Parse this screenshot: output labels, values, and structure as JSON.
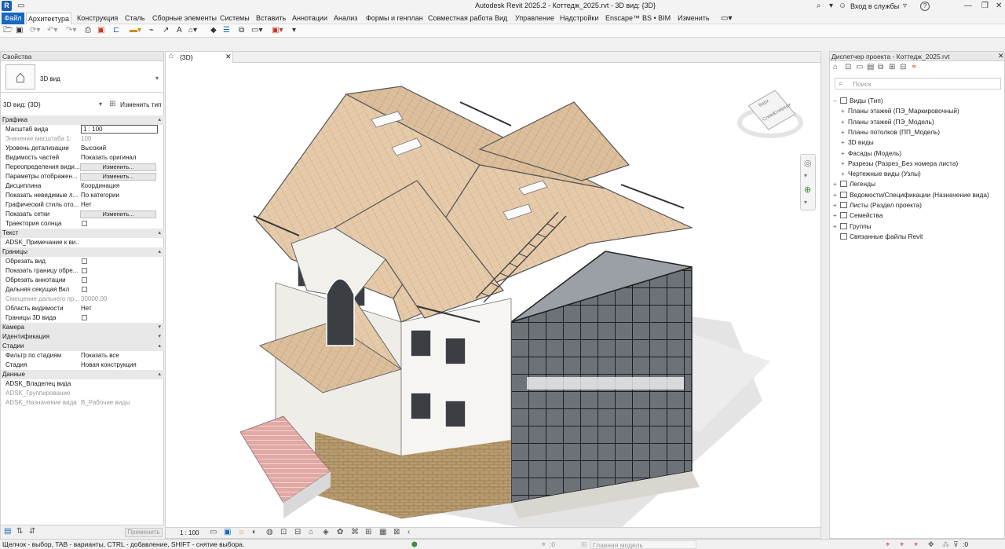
{
  "app": {
    "logo": "R",
    "window_title": "Autodesk Revit 2025.2 - Коттедж_2025.rvt - 3D вид: {3D}",
    "signin_label": "Вход в службы",
    "help_label": "?"
  },
  "menu": {
    "file": "Файл",
    "items": [
      "Архитектура",
      "Конструкция",
      "Сталь",
      "Сборные элементы",
      "Системы",
      "Вставить",
      "Аннотации",
      "Анализ",
      "Формы и генплан",
      "Совместная работа",
      "Вид",
      "Управление",
      "Надстройки",
      "Enscape™",
      "BS • BIM",
      "Изменить"
    ]
  },
  "properties": {
    "title": "Свойства",
    "type_name": "3D вид",
    "selector": "3D вид: {3D}",
    "edit_type": "Изменить тип",
    "apply": "Применить",
    "rows": [
      {
        "kind": "sec",
        "k": "Графика"
      },
      {
        "k": "Масштаб вида",
        "v": "1 : 100",
        "input": true
      },
      {
        "k": "Значение масштаба    1:",
        "v": "100",
        "dim": true
      },
      {
        "k": "Уровень детализации",
        "v": "Высокий"
      },
      {
        "k": "Видимость частей",
        "v": "Показать оригинал"
      },
      {
        "k": "Переопределения види...",
        "btn": "Изменить..."
      },
      {
        "k": "Параметры отображен...",
        "btn": "Изменить..."
      },
      {
        "k": "Дисциплина",
        "v": "Координация"
      },
      {
        "k": "Показать невидимые л...",
        "v": "По категории"
      },
      {
        "k": "Графический стиль ото...",
        "v": "Нет"
      },
      {
        "k": "Показать сетки",
        "btn": "Изменить..."
      },
      {
        "k": "Траектория солнца",
        "cb": true
      },
      {
        "kind": "sec",
        "k": "Текст"
      },
      {
        "k": "ADSK_Примечание к ви...",
        "v": ""
      },
      {
        "kind": "sec",
        "k": "Границы"
      },
      {
        "k": "Обрезать вид",
        "cb": true
      },
      {
        "k": "Показать границу обре...",
        "cb": true
      },
      {
        "k": "Обрезать аннотации",
        "cb": true
      },
      {
        "k": "Дальняя секущая Вкл",
        "cb": true
      },
      {
        "k": "Смещение дальнего пр...",
        "v": "30000,00",
        "dim": true
      },
      {
        "k": "Область видимости",
        "v": "Нет"
      },
      {
        "k": "Границы 3D вида",
        "cb": true
      },
      {
        "kind": "sec",
        "k": "Камера",
        "down": true
      },
      {
        "kind": "sec",
        "k": "Идентификация",
        "down": true
      },
      {
        "kind": "sec",
        "k": "Стадии"
      },
      {
        "k": "Фильтр по стадиям",
        "v": "Показать все"
      },
      {
        "k": "Стадия",
        "v": "Новая конструкция"
      },
      {
        "kind": "sec",
        "k": "Данные"
      },
      {
        "k": "ADSK_Владелец вида",
        "v": ""
      },
      {
        "k": "ADSK_Группирование",
        "v": "",
        "dim": true
      },
      {
        "k": "ADSK_Назначение вида",
        "v": "В_Рабочие виды",
        "dim": true
      }
    ]
  },
  "view": {
    "tab_label": "{3D}",
    "scale": "1 : 100",
    "cube_top": "Верх",
    "cube_left": "Слева",
    "cube_right": "Спереди"
  },
  "browser": {
    "title": "Диспетчер проекта - Коттедж_2025.rvt",
    "search_placeholder": "Поиск",
    "items": [
      {
        "label": "Виды (Тип)",
        "exp": "−",
        "level": 0,
        "icon": true
      },
      {
        "label": "Планы этажей (ПЭ_Маркировочный)",
        "exp": "+",
        "level": 1
      },
      {
        "label": "Планы этажей (ПЭ_Модель)",
        "exp": "+",
        "level": 1
      },
      {
        "label": "Планы потолков (ПП_Модель)",
        "exp": "+",
        "level": 1
      },
      {
        "label": "3D виды",
        "exp": "+",
        "level": 1
      },
      {
        "label": "Фасады (Модель)",
        "exp": "+",
        "level": 1
      },
      {
        "label": "Разрезы (Разрез_Без номера листа)",
        "exp": "+",
        "level": 1
      },
      {
        "label": "Чертежные виды (Узлы)",
        "exp": "+",
        "level": 1
      },
      {
        "label": "Легенды",
        "exp": "+",
        "level": 0,
        "icon": true
      },
      {
        "label": "Ведомости/Спецификации (Назначение вида)",
        "exp": "+",
        "level": 0,
        "icon": true
      },
      {
        "label": "Листы (Раздел проекта)",
        "exp": "+",
        "level": 0,
        "icon": true
      },
      {
        "label": "Семейства",
        "exp": "+",
        "level": 0,
        "icon": true
      },
      {
        "label": "Группы",
        "exp": "+",
        "level": 0,
        "icon": true
      },
      {
        "label": "Связанные файлы Revit",
        "exp": "",
        "level": 0,
        "icon": true
      }
    ]
  },
  "status": {
    "hint": "Щелчок - выбор, TAB - варианты, CTRL - добавление, SHIFT - снятие выбора.",
    "selection_count": ":0",
    "model": "Главная модель",
    "filter_count": ":0"
  },
  "colors": {
    "accent": "#1867c0",
    "roof": "#e4c9a8",
    "wall": "#eeece6",
    "stone": "#b59a6f"
  }
}
